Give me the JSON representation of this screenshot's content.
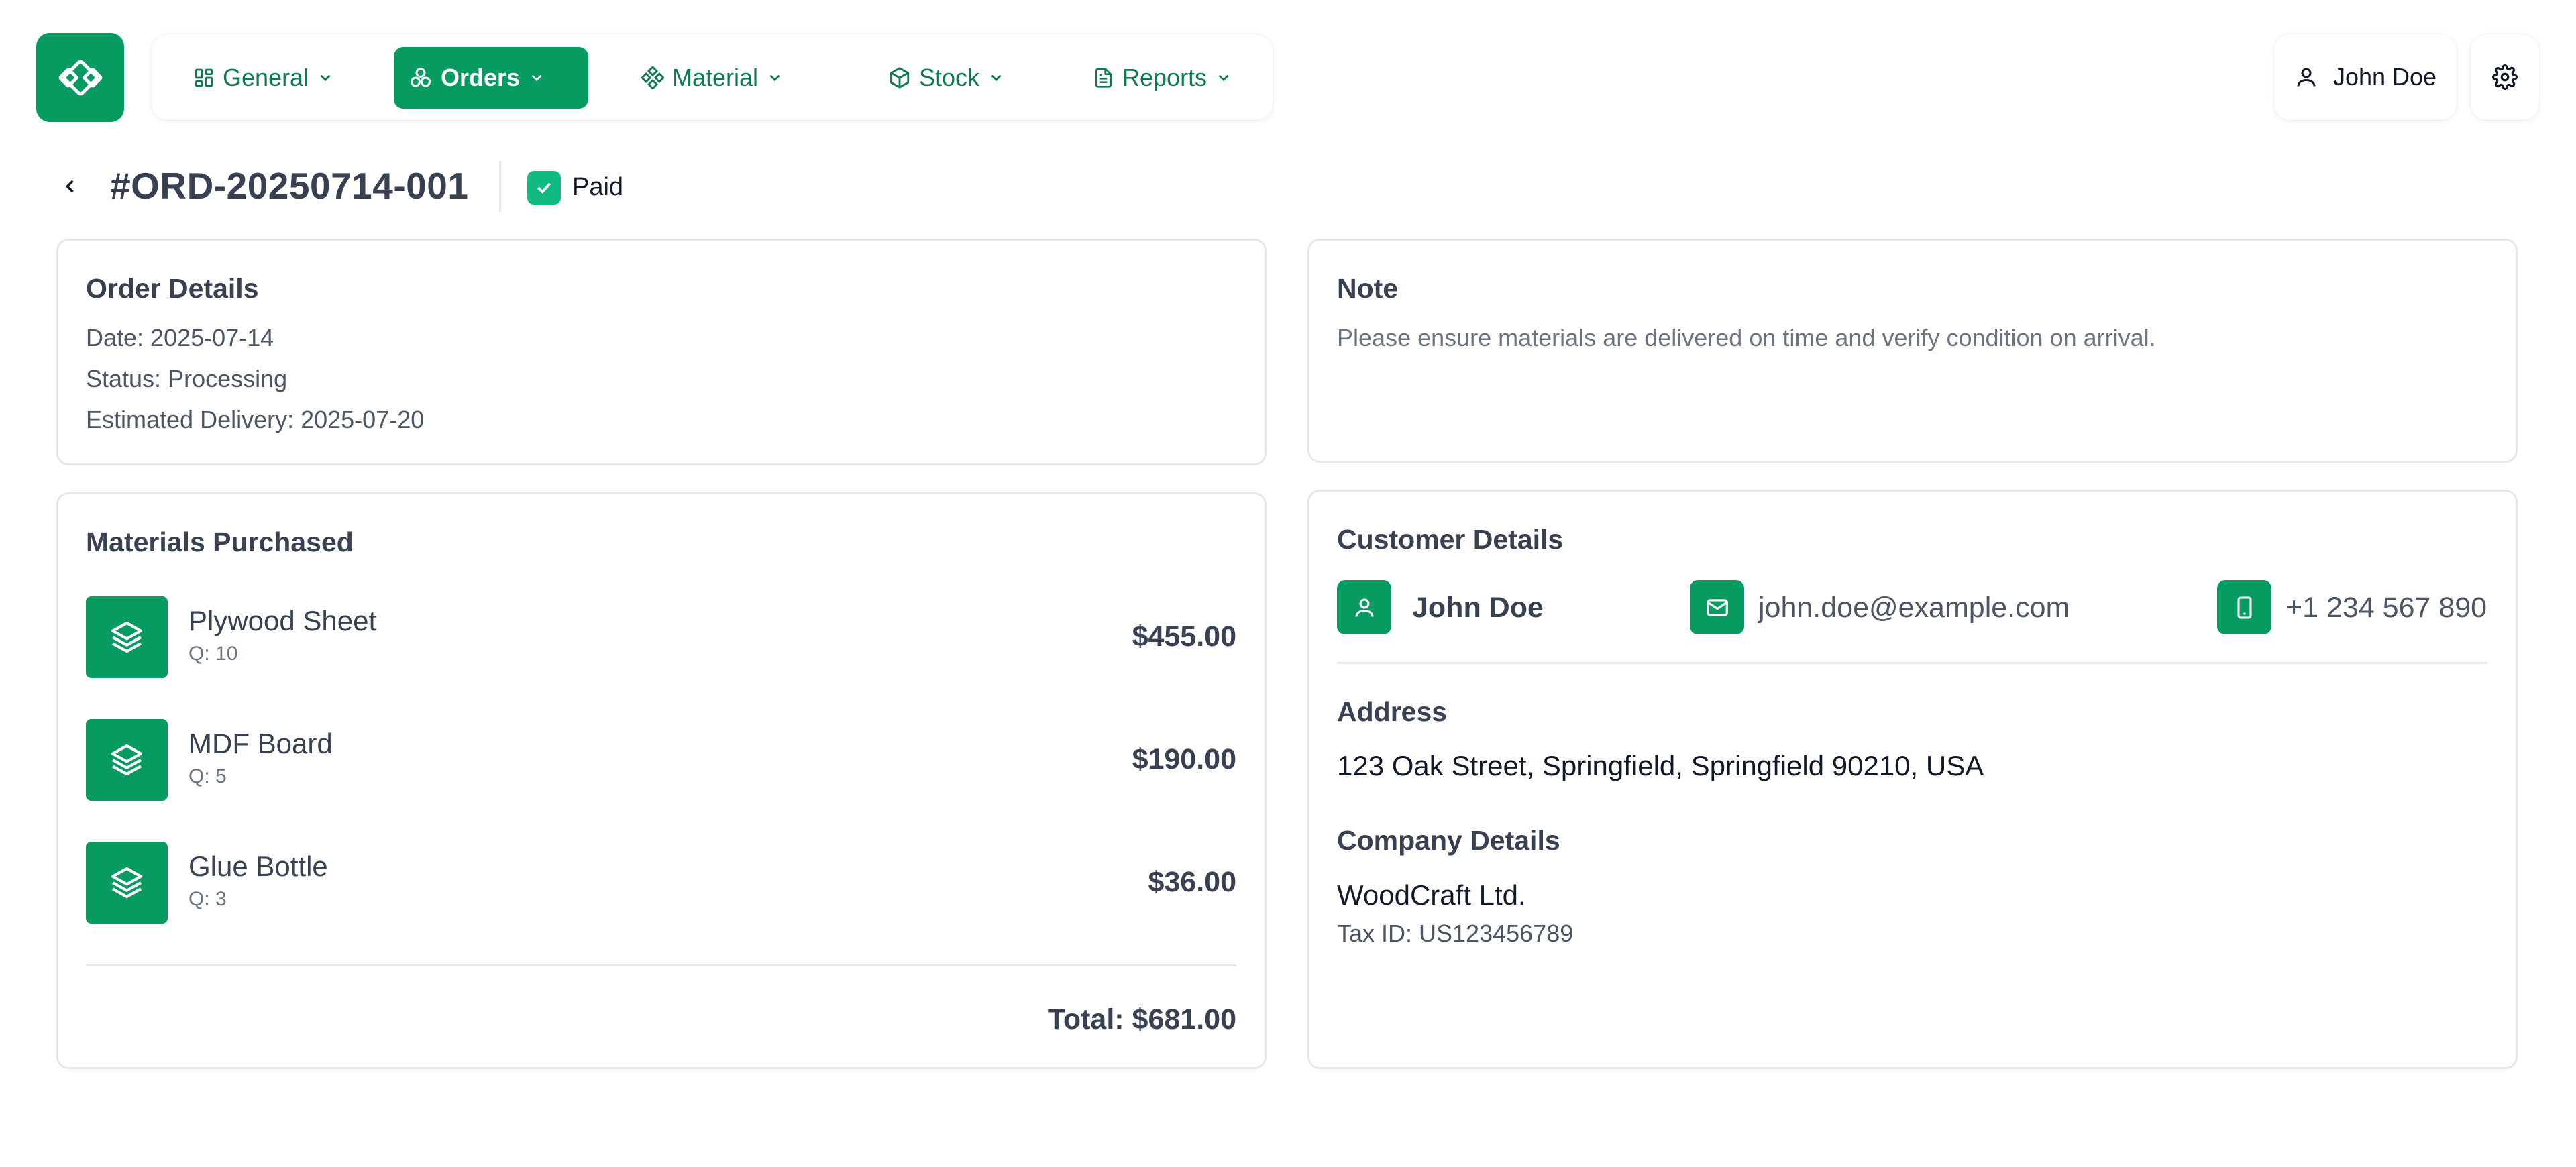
{
  "nav": {
    "items": [
      {
        "label": "General",
        "icon": "grid-icon"
      },
      {
        "label": "Orders",
        "icon": "orders-icon",
        "active": true
      },
      {
        "label": "Material",
        "icon": "material-icon"
      },
      {
        "label": "Stock",
        "icon": "box-icon"
      },
      {
        "label": "Reports",
        "icon": "file-icon"
      }
    ],
    "user_name": "John Doe"
  },
  "order": {
    "id": "#ORD-20250714-001",
    "paid_label": "Paid",
    "paid": true
  },
  "order_details": {
    "title": "Order Details",
    "date": "Date: 2025-07-14",
    "status": "Status: Processing",
    "delivery": "Estimated Delivery: 2025-07-20"
  },
  "note": {
    "title": "Note",
    "text": "Please ensure materials are delivered on time and verify condition on arrival."
  },
  "materials": {
    "title": "Materials Purchased",
    "items": [
      {
        "name": "Plywood Sheet",
        "qty": "Q: 10",
        "price": "$455.00"
      },
      {
        "name": "MDF Board",
        "qty": "Q: 5",
        "price": "$190.00"
      },
      {
        "name": "Glue Bottle",
        "qty": "Q: 3",
        "price": "$36.00"
      }
    ],
    "total": "Total: $681.00"
  },
  "customer": {
    "title": "Customer Details",
    "name": "John Doe",
    "email": "john.doe@example.com",
    "phone": "+1 234 567 890",
    "address_title": "Address",
    "address": "123 Oak Street, Springfield, Springfield 90210, USA",
    "company_title": "Company Details",
    "company_name": "WoodCraft Ltd.",
    "tax_id": "Tax ID: US123456789"
  },
  "colors": {
    "brand": "#079b61",
    "check": "#10b981",
    "border": "#e5e7eb"
  }
}
